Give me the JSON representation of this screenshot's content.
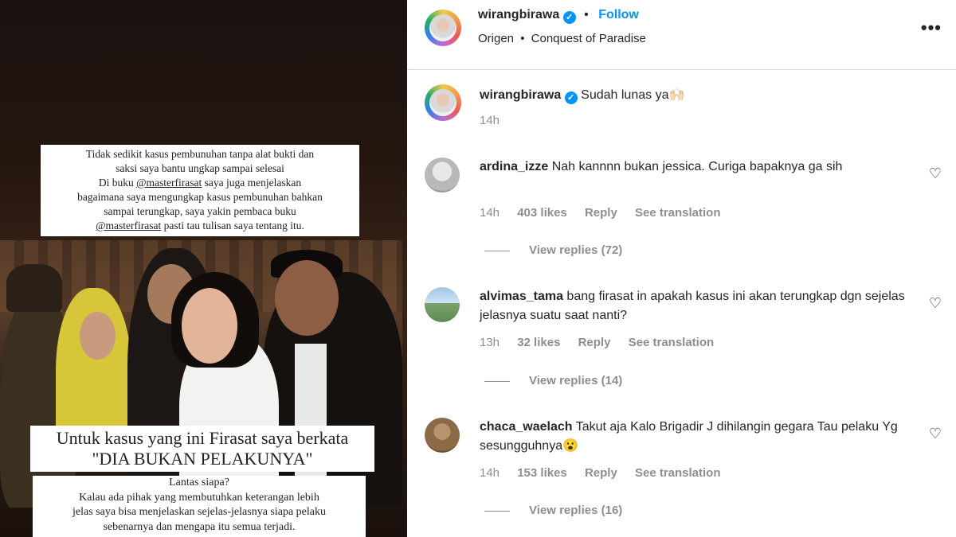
{
  "post": {
    "caption_top": {
      "line1": "Tidak sedikit kasus pembunuhan tanpa alat bukti dan",
      "line2": "saksi saya bantu ungkap sampai selesai",
      "line3_pre": "Di buku ",
      "line3_tag": "@masterfirasat",
      "line3_post": " saya juga menjelaskan",
      "line4": "bagaimana saya mengungkap kasus pembunuhan bahkan",
      "line5": "sampai terungkap, saya yakin pembaca buku",
      "line6_tag": "@masterfirasat",
      "line6_post": "  pasti tau tulisan saya tentang itu."
    },
    "caption_mid": {
      "line1": "Untuk kasus yang ini Firasat saya berkata",
      "line2": "\"DIA BUKAN PELAKUNYA\""
    },
    "caption_bottom": {
      "line1": "Lantas siapa?",
      "line2": "Kalau ada pihak yang membutuhkan keterangan lebih",
      "line3": "jelas saya bisa menjelaskan sejelas-jelasnya siapa pelaku",
      "line4": "sebenarnya dan mengapa itu semua terjadi."
    }
  },
  "header": {
    "username": "wirangbirawa",
    "verified_glyph": "✓",
    "dot": "•",
    "follow_label": "Follow",
    "audio_artist": "Origen",
    "audio_sep": "•",
    "audio_track": "Conquest of Paradise",
    "more_glyph": "•••"
  },
  "owner_caption": {
    "username": "wirangbirawa",
    "verified_glyph": "✓",
    "text": "Sudah lunas ya🙌🏻",
    "time": "14h"
  },
  "comments": [
    {
      "username": "ardina_izze",
      "text": "Nah kannnn bukan jessica. Curiga bapaknya ga sih",
      "time": "14h",
      "likes": "403 likes",
      "reply_label": "Reply",
      "translate_label": "See translation",
      "view_replies": "View replies (72)"
    },
    {
      "username": "alvimas_tama",
      "text": "bang firasat in apakah kasus ini akan terungkap dgn sejelas jelasnya suatu saat nanti?",
      "time": "13h",
      "likes": "32 likes",
      "reply_label": "Reply",
      "translate_label": "See translation",
      "view_replies": "View replies (14)"
    },
    {
      "username": "chaca_waelach",
      "text": "Takut aja Kalo Brigadir J dihilangin gegara Tau pelaku Yg sesungguhnya😮",
      "time": "14h",
      "likes": "153 likes",
      "reply_label": "Reply",
      "translate_label": "See translation",
      "view_replies": "View replies (16)"
    }
  ],
  "icons": {
    "heart": "♡"
  },
  "colors": {
    "accent": "#0095f6",
    "muted": "#8e8e8e",
    "text": "#262626"
  }
}
